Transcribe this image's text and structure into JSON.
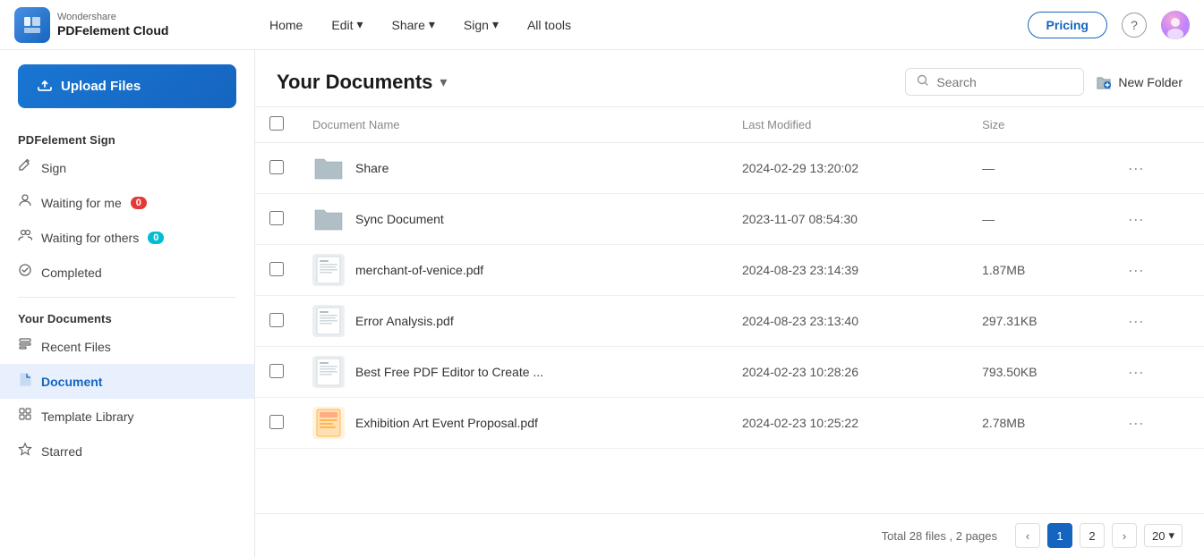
{
  "app": {
    "brand": "Wondershare",
    "product": "PDFelement Cloud"
  },
  "nav": {
    "links": [
      {
        "label": "Home",
        "has_chevron": false
      },
      {
        "label": "Edit",
        "has_chevron": true
      },
      {
        "label": "Share",
        "has_chevron": true
      },
      {
        "label": "Sign",
        "has_chevron": true
      },
      {
        "label": "All tools",
        "has_chevron": false
      }
    ],
    "pricing_label": "Pricing",
    "help_icon": "?"
  },
  "sidebar": {
    "upload_label": "Upload Files",
    "sign_section_label": "PDFelement Sign",
    "sign_items": [
      {
        "id": "sign",
        "label": "Sign",
        "icon": "✏️",
        "badge": null
      },
      {
        "id": "waiting-for-me",
        "label": "Waiting for me",
        "icon": "👤",
        "badge": "0",
        "badge_type": "red"
      },
      {
        "id": "waiting-for-others",
        "label": "Waiting for others",
        "icon": "👥",
        "badge": "0",
        "badge_type": "teal"
      },
      {
        "id": "completed",
        "label": "Completed",
        "icon": "🛡️",
        "badge": null
      }
    ],
    "docs_section_label": "Your Documents",
    "doc_items": [
      {
        "id": "recent-files",
        "label": "Recent Files",
        "icon": "📋",
        "active": false
      },
      {
        "id": "document",
        "label": "Document",
        "icon": "📁",
        "active": true
      },
      {
        "id": "template-library",
        "label": "Template Library",
        "icon": "⊞",
        "active": false
      },
      {
        "id": "starred",
        "label": "Starred",
        "icon": "⭐",
        "active": false
      }
    ]
  },
  "content": {
    "title": "Your Documents",
    "search_placeholder": "Search",
    "new_folder_label": "New Folder",
    "columns": [
      {
        "label": "Document Name"
      },
      {
        "label": "Last Modified"
      },
      {
        "label": "Size"
      }
    ],
    "files": [
      {
        "id": 1,
        "name": "Share",
        "type": "folder",
        "modified": "2024-02-29 13:20:02",
        "size": "—"
      },
      {
        "id": 2,
        "name": "Sync Document",
        "type": "folder",
        "modified": "2023-11-07 08:54:30",
        "size": "—"
      },
      {
        "id": 3,
        "name": "merchant-of-venice.pdf",
        "type": "pdf",
        "modified": "2024-08-23 23:14:39",
        "size": "1.87MB"
      },
      {
        "id": 4,
        "name": "Error Analysis.pdf",
        "type": "pdf",
        "modified": "2024-08-23 23:13:40",
        "size": "297.31KB"
      },
      {
        "id": 5,
        "name": "Best Free PDF Editor to Create ...",
        "type": "pdf",
        "modified": "2024-02-23 10:28:26",
        "size": "793.50KB"
      },
      {
        "id": 6,
        "name": "Exhibition Art Event Proposal.pdf",
        "type": "pdf_color",
        "modified": "2024-02-23 10:25:22",
        "size": "2.78MB"
      }
    ],
    "footer": {
      "total_info": "Total 28 files , 2 pages",
      "current_page": 1,
      "total_pages": 2,
      "per_page": "20"
    }
  }
}
